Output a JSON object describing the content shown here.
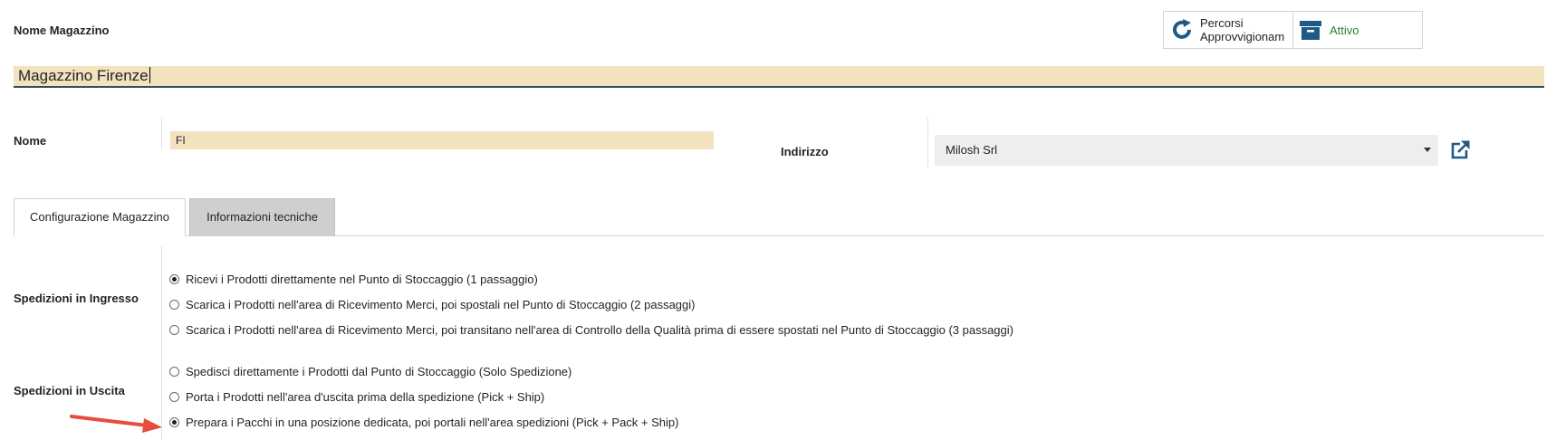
{
  "colors": {
    "field_bg": "#f2e2bd",
    "accent": "#1d5a86",
    "active_green": "#2e7d32",
    "arrow_red": "#e74c3c"
  },
  "header": {
    "name_label": "Nome Magazzino",
    "name_value": "Magazzino Firenze"
  },
  "smart_buttons": {
    "routes": {
      "icon": "refresh-icon",
      "line1": "Percorsi",
      "line2": "Approvvigionam"
    },
    "active": {
      "icon": "archive-icon",
      "label": "Attivo"
    }
  },
  "fields": {
    "short_name": {
      "label": "Nome",
      "value": "FI"
    },
    "address": {
      "label": "Indirizzo",
      "value": "Milosh Srl",
      "link_icon": "external-link-icon"
    }
  },
  "tabs": [
    {
      "label": "Configurazione Magazzino",
      "active": true
    },
    {
      "label": "Informazioni tecniche",
      "active": false
    }
  ],
  "incoming": {
    "label": "Spedizioni in Ingresso",
    "options": [
      {
        "label": "Ricevi i Prodotti direttamente nel Punto di Stoccaggio (1 passaggio)",
        "checked": true
      },
      {
        "label": "Scarica i Prodotti nell'area di Ricevimento Merci, poi spostali nel Punto di Stoccaggio (2 passaggi)",
        "checked": false
      },
      {
        "label": "Scarica i Prodotti nell'area di Ricevimento Merci, poi transitano nell'area di Controllo della Qualità prima di essere spostati nel Punto di Stoccaggio (3 passaggi)",
        "checked": false
      }
    ]
  },
  "outgoing": {
    "label": "Spedizioni in Uscita",
    "options": [
      {
        "label": "Spedisci direttamente i Prodotti dal Punto di Stoccaggio (Solo Spedizione)",
        "checked": false
      },
      {
        "label": "Porta i Prodotti nell'area d'uscita prima della spedizione (Pick + Ship)",
        "checked": false
      },
      {
        "label": "Prepara i Pacchi in una posizione dedicata, poi portali nell'area spedizioni (Pick + Pack + Ship)",
        "checked": true
      }
    ]
  }
}
